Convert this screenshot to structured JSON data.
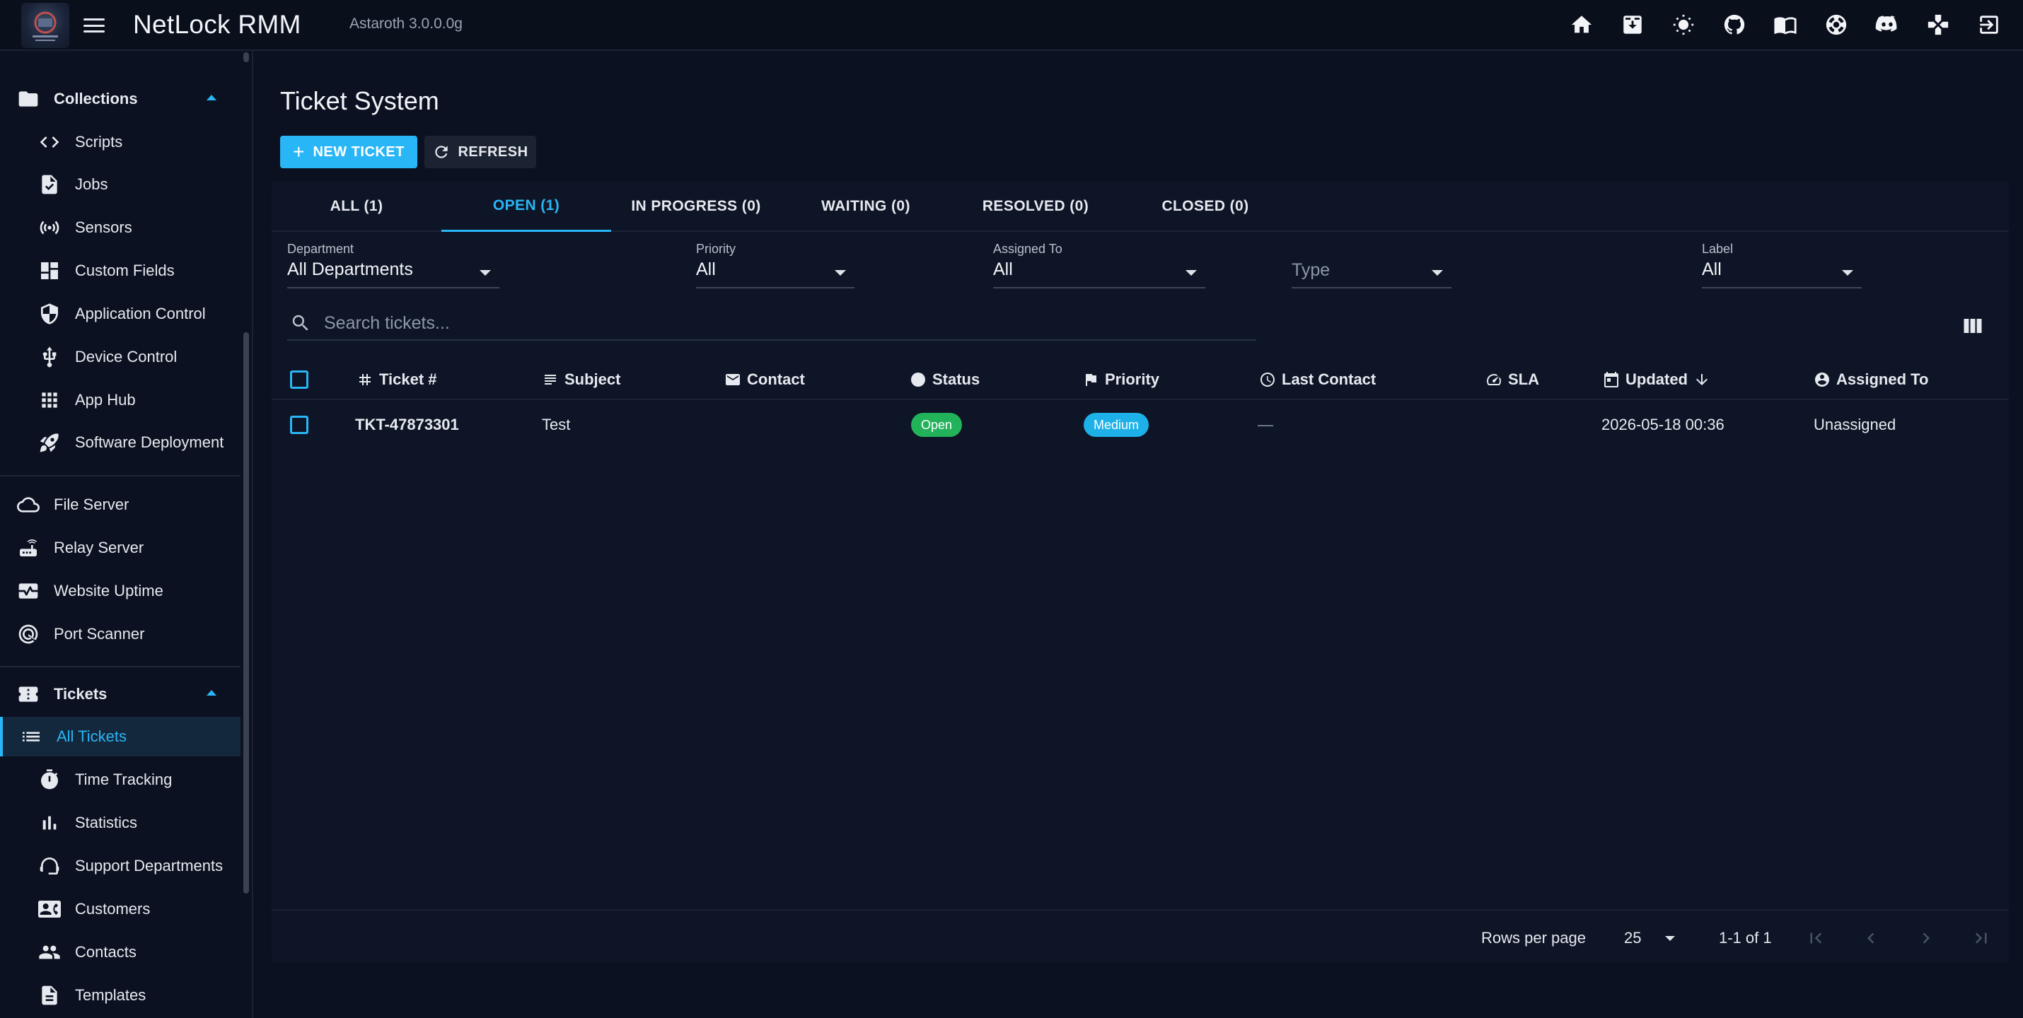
{
  "app": {
    "title": "NetLock RMM",
    "version": "Astaroth 3.0.0.0g",
    "accent_color": "#29b6f6",
    "background_color": "#0b1120"
  },
  "topbar_icons": [
    "home-icon",
    "download-icon",
    "theme-toggle-icon",
    "github-icon",
    "docs-book-icon",
    "support-lifebuoy-icon",
    "discord-icon",
    "gamepad-icon",
    "logout-icon"
  ],
  "sidebar": {
    "collections": {
      "label": "Collections"
    },
    "collection_items": [
      {
        "label": "Scripts",
        "icon": "code-icon"
      },
      {
        "label": "Jobs",
        "icon": "file-check-icon"
      },
      {
        "label": "Sensors",
        "icon": "sensor-icon"
      },
      {
        "label": "Custom Fields",
        "icon": "dashboard-icon"
      },
      {
        "label": "Application Control",
        "icon": "shield-icon"
      },
      {
        "label": "Device Control",
        "icon": "usb-icon"
      },
      {
        "label": "App Hub",
        "icon": "apps-grid-icon"
      },
      {
        "label": "Software Deployment",
        "icon": "rocket-icon"
      }
    ],
    "servers": [
      {
        "label": "File Server",
        "icon": "cloud-icon"
      },
      {
        "label": "Relay Server",
        "icon": "router-icon"
      },
      {
        "label": "Website Uptime",
        "icon": "monitor-heart-icon"
      },
      {
        "label": "Port Scanner",
        "icon": "radar-icon"
      }
    ],
    "tickets": {
      "label": "Tickets"
    },
    "ticket_items": [
      {
        "label": "All Tickets",
        "icon": "list-icon",
        "active": true
      },
      {
        "label": "Time Tracking",
        "icon": "timer-icon"
      },
      {
        "label": "Statistics",
        "icon": "bar-chart-icon"
      },
      {
        "label": "Support Departments",
        "icon": "headset-icon"
      },
      {
        "label": "Customers",
        "icon": "contact-card-icon"
      },
      {
        "label": "Contacts",
        "icon": "people-icon"
      },
      {
        "label": "Templates",
        "icon": "document-icon"
      }
    ]
  },
  "main": {
    "title": "Ticket System",
    "new_ticket_label": "NEW TICKET",
    "refresh_label": "REFRESH",
    "tabs": [
      {
        "label": "ALL (1)"
      },
      {
        "label": "OPEN (1)",
        "active": true
      },
      {
        "label": "IN PROGRESS (0)"
      },
      {
        "label": "WAITING (0)"
      },
      {
        "label": "RESOLVED (0)"
      },
      {
        "label": "CLOSED (0)"
      }
    ],
    "filters": {
      "department": {
        "label": "Department",
        "value": "All Departments"
      },
      "priority": {
        "label": "Priority",
        "value": "All"
      },
      "assigned_to": {
        "label": "Assigned To",
        "value": "All"
      },
      "type": {
        "placeholder": "Type"
      },
      "label": {
        "label": "Label",
        "value": "All"
      }
    },
    "search_placeholder": "Search tickets...",
    "columns": {
      "ticket": "Ticket #",
      "subject": "Subject",
      "contact": "Contact",
      "status": "Status",
      "priority": "Priority",
      "last_contact": "Last Contact",
      "sla": "SLA",
      "updated": "Updated",
      "assigned_to": "Assigned To"
    },
    "rows": [
      {
        "ticket": "TKT-47873301",
        "subject": "Test",
        "contact": "",
        "status": "Open",
        "priority": "Medium",
        "last_contact": "—",
        "sla": "",
        "updated": "2026-05-18 00:36",
        "assigned_to": "Unassigned"
      }
    ],
    "pagination": {
      "rows_per_page_label": "Rows per page",
      "rows_per_page": "25",
      "range": "1-1 of 1"
    }
  }
}
